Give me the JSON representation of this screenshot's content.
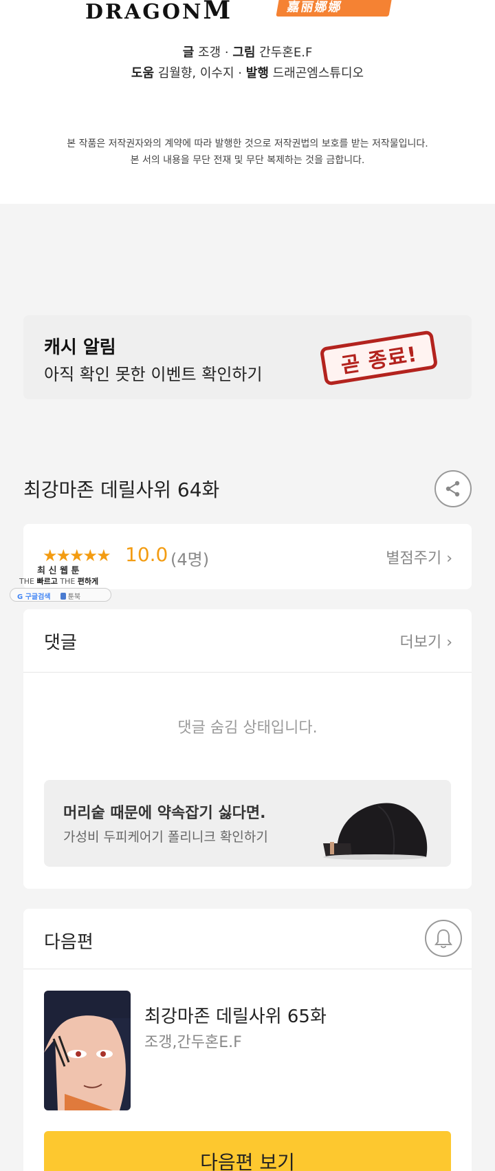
{
  "header": {
    "logo_left": "DRAGON",
    "logo_left_mark": "M",
    "logo_right": "嘉丽娜娜",
    "credit_line1": {
      "k1": "글",
      "v1": "조갱",
      "sep": "·",
      "k2": "그림",
      "v2": "간두혼E.F"
    },
    "credit_line2": {
      "k1": "도움",
      "v1": "김월향, 이수지",
      "sep": "·",
      "k2": "발행",
      "v2": "드래곤엠스튜디오"
    },
    "notice1": "본 작품은 저작권자와의 계약에 따라 발행한 것으로 저작권법의 보호를 받는 저작물입니다.",
    "notice2": "본 서의 내용을 무단 전재 및 무단 복제하는 것을 금합니다."
  },
  "cash_alert": {
    "title": "캐시 알림",
    "subtitle": "아직 확인 못한 이벤트 확인하기",
    "stamp": "곧 종료!"
  },
  "episode": {
    "title": "최강마존 데릴사위 64화",
    "share_icon": "share-icon"
  },
  "rating": {
    "stars": "★★★★★",
    "score": "10.0",
    "count": "(4명)",
    "rate_link": "별점주기 ›"
  },
  "watermark": {
    "line1": "최 신 웹 툰",
    "line2_a": "THE",
    "line2_b": "빠르고",
    "line2_c": "THE",
    "line2_d": "편하게",
    "pill_a": "G 구글검색",
    "pill_b": "툰북"
  },
  "comments": {
    "header": "댓글",
    "more": "더보기 ›",
    "hidden_text": "댓글 숨김 상태입니다."
  },
  "ad": {
    "headline": "머리숱 때문에 약속잡기 싫다면.",
    "subline": "가성비 두피케어기 폴리니크 확인하기"
  },
  "next_episode": {
    "header": "다음편",
    "title": "최강마존 데릴사위 65화",
    "author": "조갱,간두혼E.F",
    "button": "다음편 보기"
  },
  "colors": {
    "accent_star": "#f39c12",
    "button_yellow": "#fdc82f",
    "stamp_red": "#b3231e",
    "background": "#f4f4f4"
  }
}
